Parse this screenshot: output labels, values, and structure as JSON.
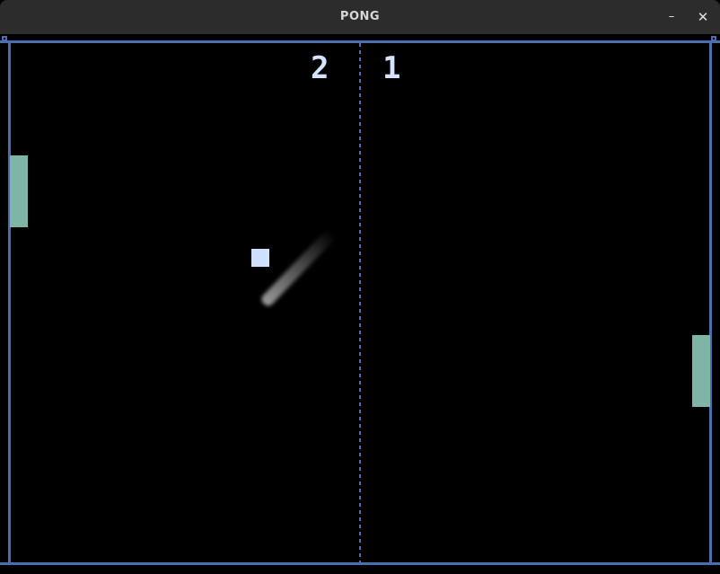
{
  "window": {
    "title": "PONG",
    "minimize_label": "–",
    "close_label": "✕"
  },
  "game": {
    "score_left": "2",
    "score_right": "1"
  },
  "colors": {
    "background": "#000000",
    "walls": "#4a6fae",
    "paddles": "#7fb5a7",
    "ball": "#cfe0ff",
    "score": "#d6e4ff"
  }
}
